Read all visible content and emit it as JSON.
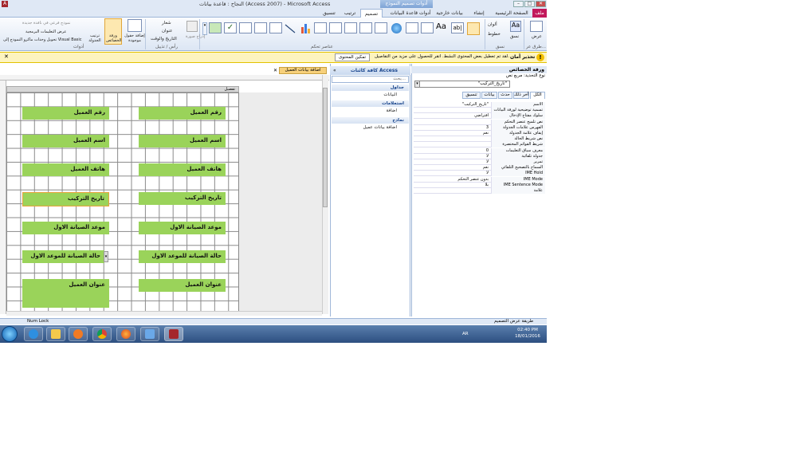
{
  "window": {
    "title": "النجاح : قاعدة بيانات (Access 2007) - Microsoft Access",
    "context_tab_group": "أدوات تصميم النموذج",
    "min": "–",
    "max": "□",
    "close": "✕"
  },
  "tabs": [
    {
      "label": "ملف"
    },
    {
      "label": "الصفحة الرئيسية"
    },
    {
      "label": "إنشاء"
    },
    {
      "label": "بيانات خارجية"
    },
    {
      "label": "أدوات قاعدة البيانات"
    },
    {
      "label": "تصميم"
    },
    {
      "label": "ترتيب"
    },
    {
      "label": "تنسيق"
    }
  ],
  "ribbon": {
    "views_group": {
      "view_label": "عرض",
      "group": "طرق عر..."
    },
    "themes_group": {
      "colors": "ألوان",
      "fonts": "خطوط",
      "themes": "نسق",
      "group": "نسق"
    },
    "controls_group": {
      "group": "عناصر تحكم"
    },
    "header_group": {
      "logo": "شعار",
      "title": "عنوان",
      "datetime": "التاريخ والوقت",
      "insert_image": "إدراج صورة",
      "group": "رأس / تذييل"
    },
    "tools_group": {
      "add_existing": "إضافة حقول موجودة",
      "property_sheet": "ورقة الخصائص",
      "tab_order": "ترتيب الجدولة",
      "subform": "نموذج فرعي في نافذة جديدة",
      "view_code": "عرض التعليمات البرمجية",
      "convert_macros": "تحويل وحدات ماكرو النموذج إلى Visual Basic",
      "group": "أدوات"
    }
  },
  "security_bar": {
    "icon": "!",
    "title": "تحذير أمان",
    "message": "لقد تم تعطيل بعض المحتوى النشط. انقر للحصول على مزيد من التفاصيل.",
    "enable_button": "تمكين المحتوى",
    "close": "✕"
  },
  "document": {
    "tab_label": "اضافة بيانات العميل",
    "close": "✕",
    "section_header": "تفصيل",
    "fields": [
      {
        "label": "رقم العميل",
        "value": "رقم العميل"
      },
      {
        "label": "اسم العميل",
        "value": "اسم العميل"
      },
      {
        "label": "هاتف العميل",
        "value": "هاتف العميل"
      },
      {
        "label": "تاريخ التركيب",
        "value": "تاريخ التركيب"
      },
      {
        "label": "موعد الصيانة الاول",
        "value": "موعد الصيانة الاول"
      },
      {
        "label": "حالة الصيانة للموعد الاول",
        "value": "حالة الصيانة للموعد الاول"
      },
      {
        "label": "عنوان العميل",
        "value": "عنوان العميل"
      }
    ],
    "combo_arrow": "▾"
  },
  "nav_pane": {
    "title": "كافة كائنات Access",
    "search_placeholder": "بحث...",
    "groups": [
      {
        "label": "جداول",
        "items": [
          "البيانات"
        ]
      },
      {
        "label": "استعلامات",
        "items": [
          "اضافة"
        ]
      },
      {
        "label": "نماذج",
        "items": [
          "اضافة بيانات عميل"
        ]
      }
    ]
  },
  "property_sheet": {
    "title": "ورقة الخصائص",
    "selection_type": "نوع التحديد: مربع نص",
    "selected_control": "\"تاريخ_التركيب\"",
    "dropdown_arrow": "▾",
    "tabs": [
      "الكل",
      "آخر ذلك",
      "حدث",
      "بيانات",
      "تنسيق"
    ],
    "rows": [
      {
        "name": "الاسم",
        "value": "\"تاريخ_التركيب\""
      },
      {
        "name": "تسمية توضيحية لورقة البيانات",
        "value": ""
      },
      {
        "name": "سلوك مفتاح الإدخال",
        "value": "افتراضي"
      },
      {
        "name": "نص تلميح عنصر التحكم",
        "value": ""
      },
      {
        "name": "الفهرس علامات الجدولة",
        "value": "3"
      },
      {
        "name": "إيقاف علامة الجدولة",
        "value": "نعم"
      },
      {
        "name": "نص شريط الحالة",
        "value": ""
      },
      {
        "name": "شريط القوائم المختصرة",
        "value": ""
      },
      {
        "name": "معرف سياق التعليمات",
        "value": "0"
      },
      {
        "name": "جدولة تلقائية",
        "value": "لا"
      },
      {
        "name": "تمرير",
        "value": "لا"
      },
      {
        "name": "السماح بالتصحيح التلقائي",
        "value": "نعم"
      },
      {
        "name": "IME Hold",
        "value": "لا"
      },
      {
        "name": "IME Mode",
        "value": "بدون عنصر التحكم"
      },
      {
        "name": "IME Sentence Mode",
        "value": "بلا"
      },
      {
        "name": "علامة",
        "value": ""
      }
    ]
  },
  "status_bar": {
    "left": "Num Lock",
    "right": "طريقة عرض التصميم"
  },
  "taskbar": {
    "lang": "AR",
    "time": "02:40 PM",
    "date": "18/01/2016"
  }
}
